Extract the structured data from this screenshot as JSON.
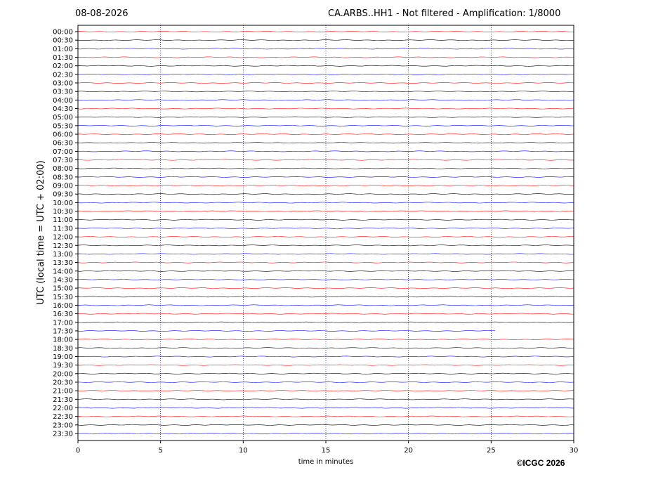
{
  "header": {
    "date": "08-08-2026",
    "title": "CA.ARBS..HH1 - Not filtered - Amplification: 1/8000"
  },
  "footer": {
    "copyright": "©ICGC 2026"
  },
  "chart_data": {
    "type": "line",
    "title": "CA.ARBS..HH1 - Not filtered - Amplification: 1/8000",
    "xlabel": "time in minutes",
    "ylabel": "UTC (local time = UTC + 02:00)",
    "xlim": [
      0,
      30
    ],
    "xticks": [
      0,
      5,
      10,
      15,
      20,
      25,
      30
    ],
    "vertical_grid_at": [
      5,
      10,
      15,
      20,
      25
    ],
    "rows": [
      "00:00",
      "00:30",
      "01:00",
      "01:30",
      "02:00",
      "02:30",
      "03:00",
      "03:30",
      "04:00",
      "04:30",
      "05:00",
      "05:30",
      "06:00",
      "06:30",
      "07:00",
      "07:30",
      "08:00",
      "08:30",
      "09:00",
      "09:30",
      "10:00",
      "10:30",
      "11:00",
      "11:30",
      "12:00",
      "12:30",
      "13:00",
      "13:30",
      "14:00",
      "14:30",
      "15:00",
      "15:30",
      "16:00",
      "16:30",
      "17:00",
      "17:30",
      "18:00",
      "18:30",
      "19:00",
      "19:30",
      "20:00",
      "20:30",
      "21:00",
      "21:30",
      "22:00",
      "22:30",
      "23:00",
      "23:30"
    ],
    "row_color_cycle": [
      "#ff0000",
      "#000000",
      "#0000ff"
    ],
    "trace_end_minutes": {
      "17:30": 25.3
    },
    "legend": "none",
    "grid": "vertical dotted"
  }
}
